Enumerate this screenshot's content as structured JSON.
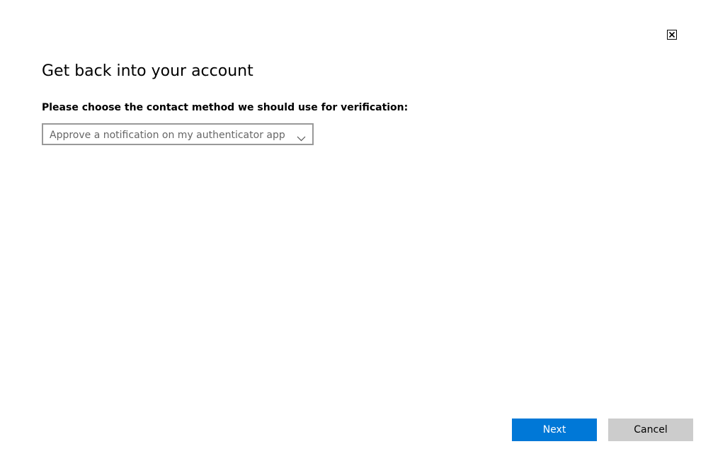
{
  "dialog": {
    "title": "Get back into your account",
    "prompt": "Please choose the contact method we should use for verification:",
    "contact_method": {
      "selected": "Approve a notification on my authenticator app"
    },
    "buttons": {
      "next": "Next",
      "cancel": "Cancel"
    }
  },
  "colors": {
    "primary_button": "#0078d7",
    "secondary_button": "#cccccc",
    "select_border": "#999999"
  },
  "icons": {
    "close": "close-icon",
    "dropdown": "chevron-down-icon"
  }
}
